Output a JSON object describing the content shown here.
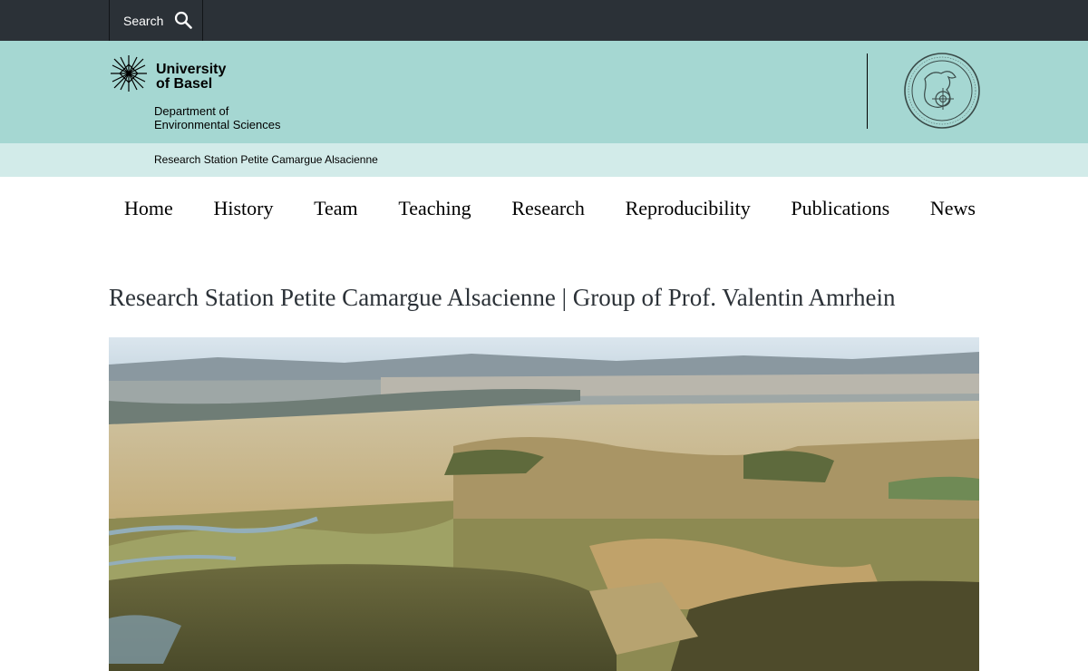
{
  "topbar": {
    "search_label": "Search",
    "search_icon": "search-icon"
  },
  "header": {
    "logo_line1": "University",
    "logo_line2": "of Basel",
    "department_line1": "Department of",
    "department_line2": "Environmental Sciences",
    "background": "#a5d7d2",
    "seal_icon": "university-seal-icon"
  },
  "subbar": {
    "title": "Research Station Petite Camargue Alsacienne",
    "background": "#d2ebe9"
  },
  "nav": {
    "items": [
      {
        "label": "Home"
      },
      {
        "label": "History"
      },
      {
        "label": "Team"
      },
      {
        "label": "Teaching"
      },
      {
        "label": "Research"
      },
      {
        "label": "Reproducibility"
      },
      {
        "label": "Publications"
      },
      {
        "label": "News"
      }
    ]
  },
  "main": {
    "title": "Research Station Petite Camargue Alsacienne | Group of Prof. Valentin Amrhein"
  },
  "colors": {
    "topbar": "#2b3137",
    "title_text": "#2b3137"
  }
}
